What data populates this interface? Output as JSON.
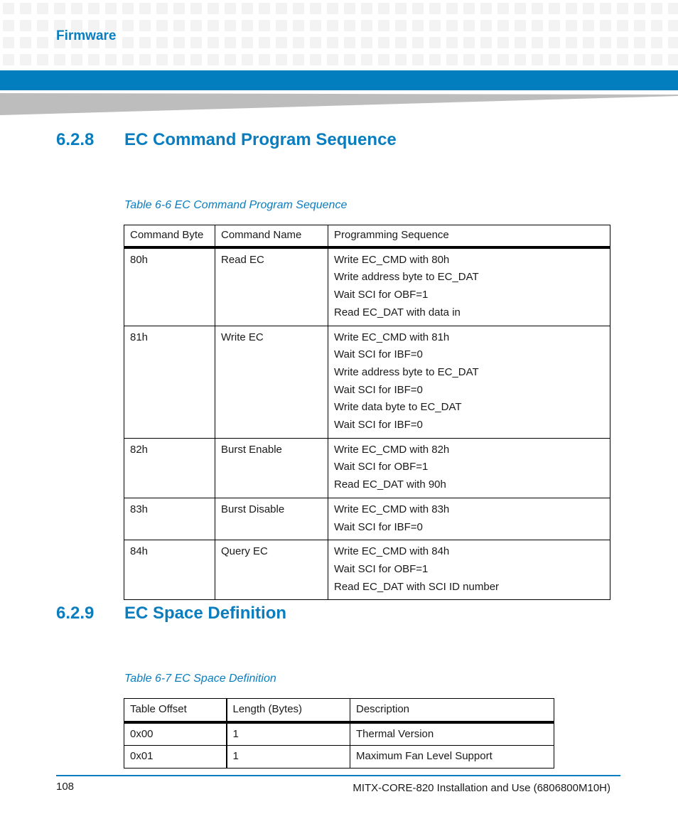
{
  "header": {
    "section_label": "Firmware",
    "colors": {
      "accent": "#027dbe",
      "heading": "#0a7dbf",
      "grid": "#f3f3f3",
      "wedge": "#bdbdbd"
    }
  },
  "sections": [
    {
      "number": "6.2.8",
      "title": "EC Command Program Sequence",
      "table_caption": "Table 6-6 EC Command Program Sequence",
      "table": {
        "columns": [
          "Command Byte",
          "Command Name",
          "Programming Sequence"
        ],
        "rows": [
          {
            "byte": "80h",
            "name": "Read EC",
            "sequence": [
              "Write EC_CMD with 80h",
              "Write address byte to EC_DAT",
              "Wait SCI for OBF=1",
              "Read EC_DAT with data in"
            ]
          },
          {
            "byte": "81h",
            "name": "Write EC",
            "sequence": [
              "Write EC_CMD with 81h",
              "Wait SCI for IBF=0",
              "Write address byte to EC_DAT",
              "Wait SCI for IBF=0",
              "Write data byte to EC_DAT",
              "Wait SCI for IBF=0"
            ]
          },
          {
            "byte": "82h",
            "name": "Burst Enable",
            "sequence": [
              "Write EC_CMD with 82h",
              "Wait SCI for OBF=1",
              "Read EC_DAT with 90h"
            ]
          },
          {
            "byte": "83h",
            "name": "Burst Disable",
            "sequence": [
              "Write EC_CMD with 83h",
              "Wait SCI for IBF=0"
            ]
          },
          {
            "byte": "84h",
            "name": "Query EC",
            "sequence": [
              "Write EC_CMD with 84h",
              "Wait SCI for OBF=1",
              "Read EC_DAT with SCI ID number"
            ]
          }
        ]
      }
    },
    {
      "number": "6.2.9",
      "title": "EC Space Definition",
      "table_caption": "Table 6-7 EC Space Definition",
      "table": {
        "columns": [
          "Table Offset",
          "Length (Bytes)",
          "Description"
        ],
        "rows": [
          {
            "offset": "0x00",
            "length": "1",
            "description": "Thermal Version"
          },
          {
            "offset": "0x01",
            "length": "1",
            "description": "Maximum Fan Level Support"
          }
        ]
      }
    }
  ],
  "footer": {
    "page_number": "108",
    "document_title": "MITX-CORE-820 Installation and Use (6806800M10H)"
  }
}
